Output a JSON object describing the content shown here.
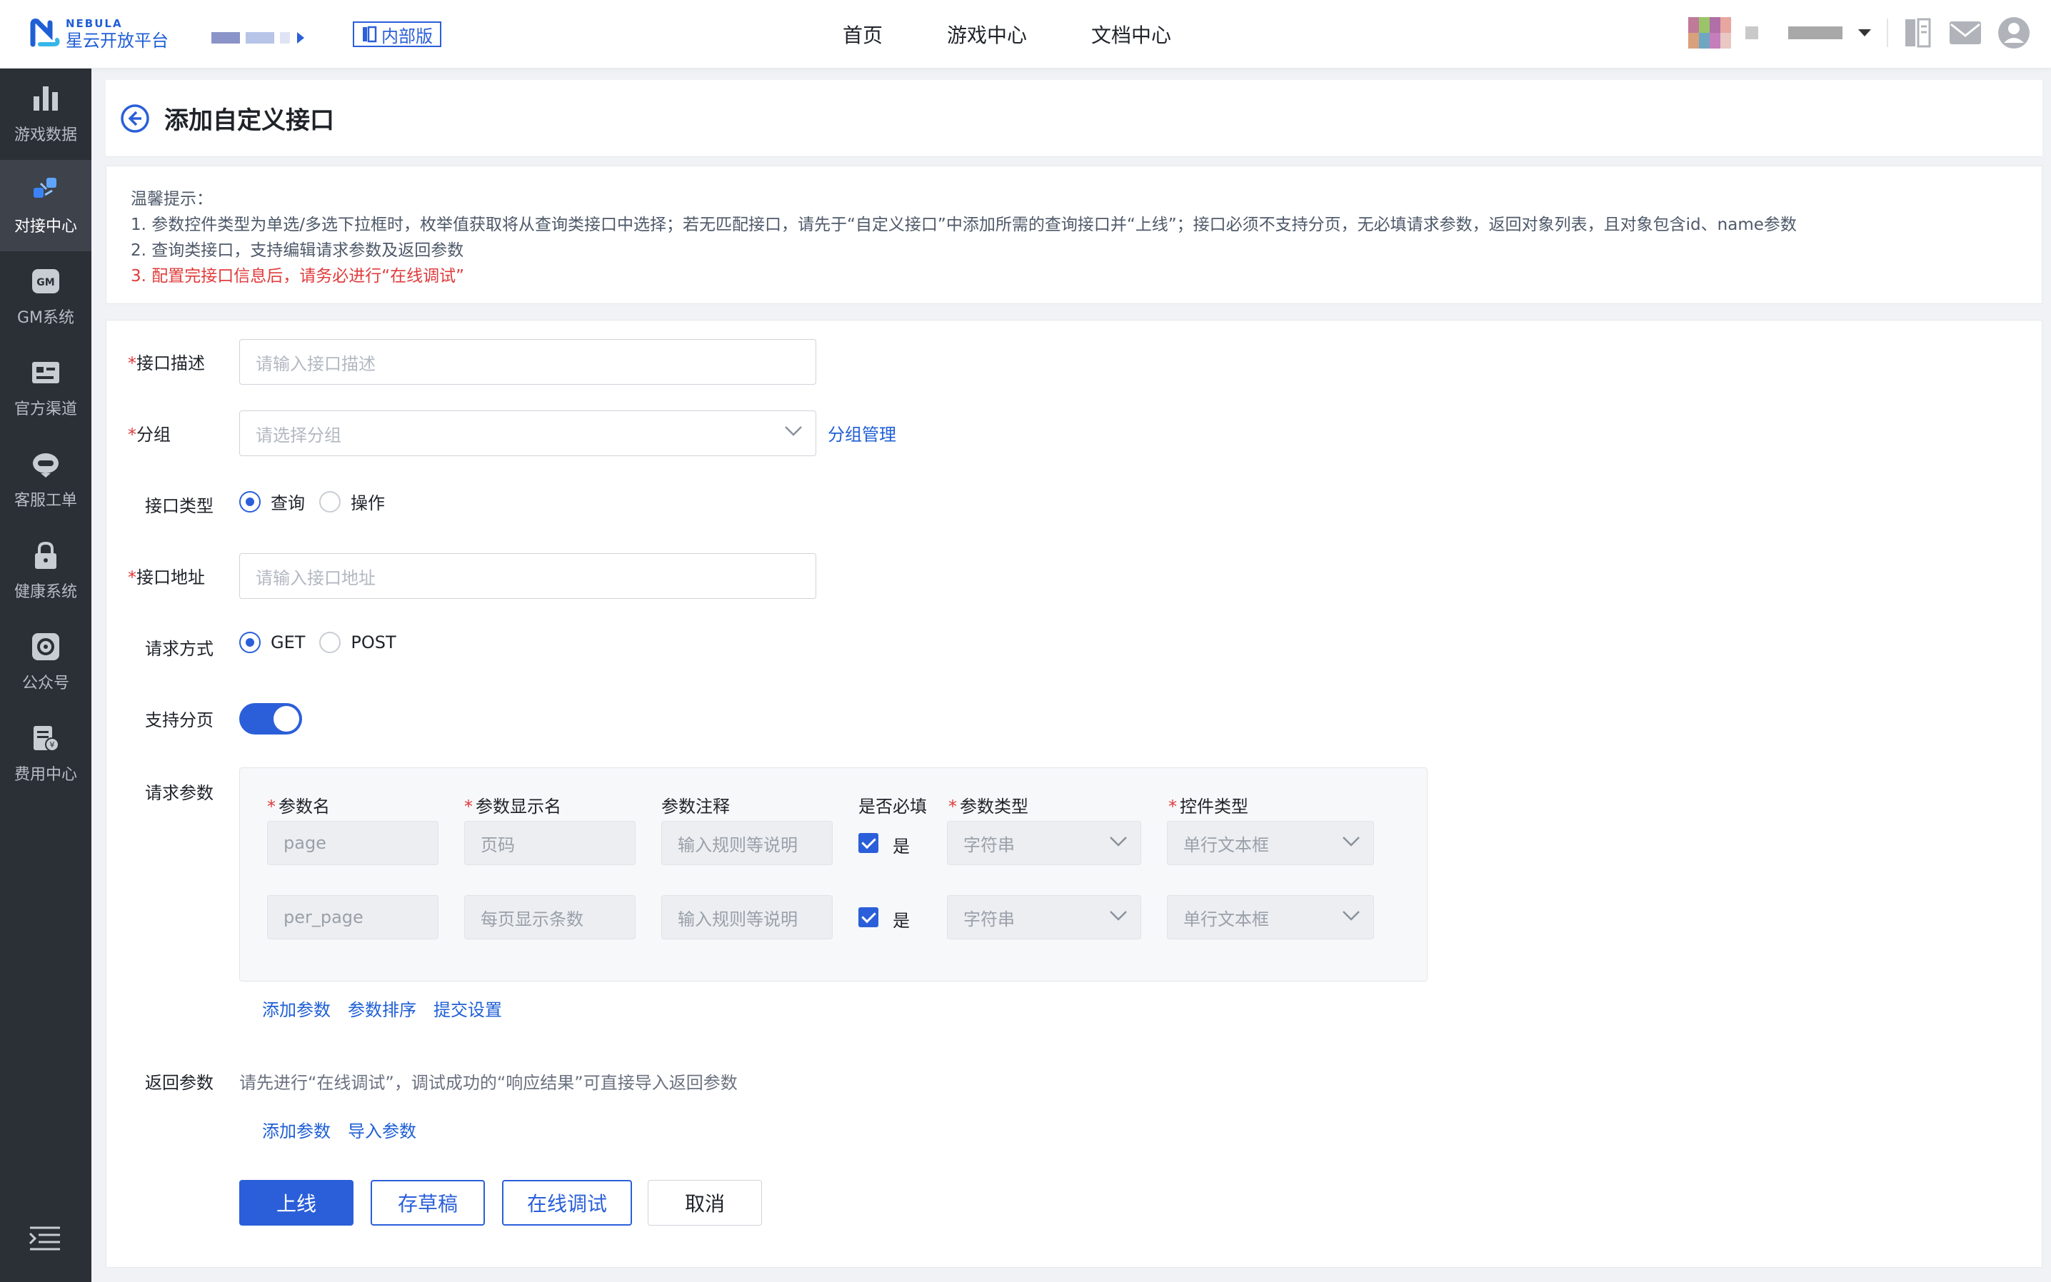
{
  "brand": {
    "en": "NEBULA",
    "cn": "星云开放平台",
    "color": "#1f5fd6"
  },
  "header": {
    "env_badge": "内部版",
    "nav": [
      "首页",
      "游戏中心",
      "文档中心"
    ],
    "icons": [
      "docs-icon",
      "mail-icon",
      "user-icon"
    ]
  },
  "sidebar": {
    "items": [
      {
        "label": "游戏数据",
        "icon": "bar-chart-icon"
      },
      {
        "label": "对接中心",
        "icon": "connect-icon",
        "active": true
      },
      {
        "label": "GM系统",
        "icon": "gm-icon"
      },
      {
        "label": "官方渠道",
        "icon": "id-card-icon"
      },
      {
        "label": "客服工单",
        "icon": "headset-icon"
      },
      {
        "label": "健康系统",
        "icon": "lock-icon"
      },
      {
        "label": "公众号",
        "icon": "wechat-icon"
      },
      {
        "label": "费用中心",
        "icon": "bill-icon"
      }
    ]
  },
  "page": {
    "title": "添加自定义接口"
  },
  "tips": {
    "title": "温馨提示：",
    "lines": [
      "1. 参数控件类型为单选/多选下拉框时，枚举值获取将从查询类接口中选择；若无匹配接口，请先于“自定义接口”中添加所需的查询接口并“上线”；接口必须不支持分页，无必填请求参数，返回对象列表，且对象包含id、name参数",
      "2. 查询类接口，支持编辑请求参数及返回参数"
    ],
    "warning": "3. 配置完接口信息后，请务必进行“在线调试”"
  },
  "form": {
    "desc": {
      "label": "接口描述",
      "placeholder": "请输入接口描述"
    },
    "group": {
      "label": "分组",
      "placeholder": "请选择分组",
      "manage": "分组管理"
    },
    "type": {
      "label": "接口类型",
      "options": [
        "查询",
        "操作"
      ],
      "selected": "查询"
    },
    "url": {
      "label": "接口地址",
      "placeholder": "请输入接口地址"
    },
    "method": {
      "label": "请求方式",
      "options": [
        "GET",
        "POST"
      ],
      "selected": "GET"
    },
    "paging": {
      "label": "支持分页",
      "on": true
    },
    "req_params": {
      "label": "请求参数",
      "headers": [
        "参数名",
        "参数显示名",
        "参数注释",
        "是否必填",
        "参数类型",
        "控件类型"
      ],
      "rows": [
        {
          "name": "page",
          "display": "页码",
          "note_placeholder": "输入规则等说明",
          "required": "是",
          "type": "字符串",
          "control": "单行文本框"
        },
        {
          "name": "per_page",
          "display": "每页显示条数",
          "note_placeholder": "输入规则等说明",
          "required": "是",
          "type": "字符串",
          "control": "单行文本框"
        }
      ],
      "actions": [
        "添加参数",
        "参数排序",
        "提交设置"
      ]
    },
    "resp_params": {
      "label": "返回参数",
      "hint": "请先进行“在线调试”，调试成功的“响应结果”可直接导入返回参数",
      "actions": [
        "添加参数",
        "导入参数"
      ]
    },
    "buttons": {
      "publish": "上线",
      "draft": "存草稿",
      "debug": "在线调试",
      "cancel": "取消"
    }
  }
}
